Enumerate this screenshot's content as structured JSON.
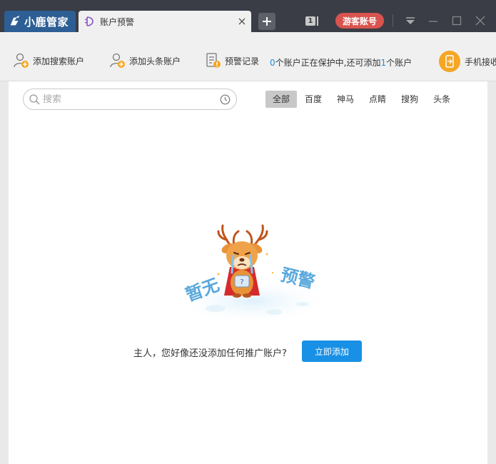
{
  "app": {
    "brand": "小鹿管家",
    "tab_label": "账户预警",
    "window_count": "1",
    "guest_label": "游客账号"
  },
  "toolbar": {
    "add_search_account": "添加搜索账户",
    "add_toutiao_account": "添加头条账户",
    "alert_records": "预警记录",
    "status_count_protected": "0",
    "status_mid": "个账户正在保护中,还可添加",
    "status_count_available": "1",
    "status_tail": "个账户",
    "phone_label": "手机接收"
  },
  "search": {
    "placeholder": "搜索",
    "value": ""
  },
  "filters": [
    {
      "label": "全部",
      "active": true
    },
    {
      "label": "百度",
      "active": false
    },
    {
      "label": "神马",
      "active": false
    },
    {
      "label": "点睛",
      "active": false
    },
    {
      "label": "搜狗",
      "active": false
    },
    {
      "label": "头条",
      "active": false
    }
  ],
  "empty": {
    "left_word": "暂无",
    "right_word": "预警",
    "badge": "?",
    "message": "主人，您好像还没添加任何推广账户?",
    "action": "立即添加"
  },
  "colors": {
    "titlebar": "#3a3d46",
    "brand_bg": "#2d5f94",
    "guest": "#d9534f",
    "accent_blue": "#1890e6",
    "phone_orange": "#f5a623"
  }
}
